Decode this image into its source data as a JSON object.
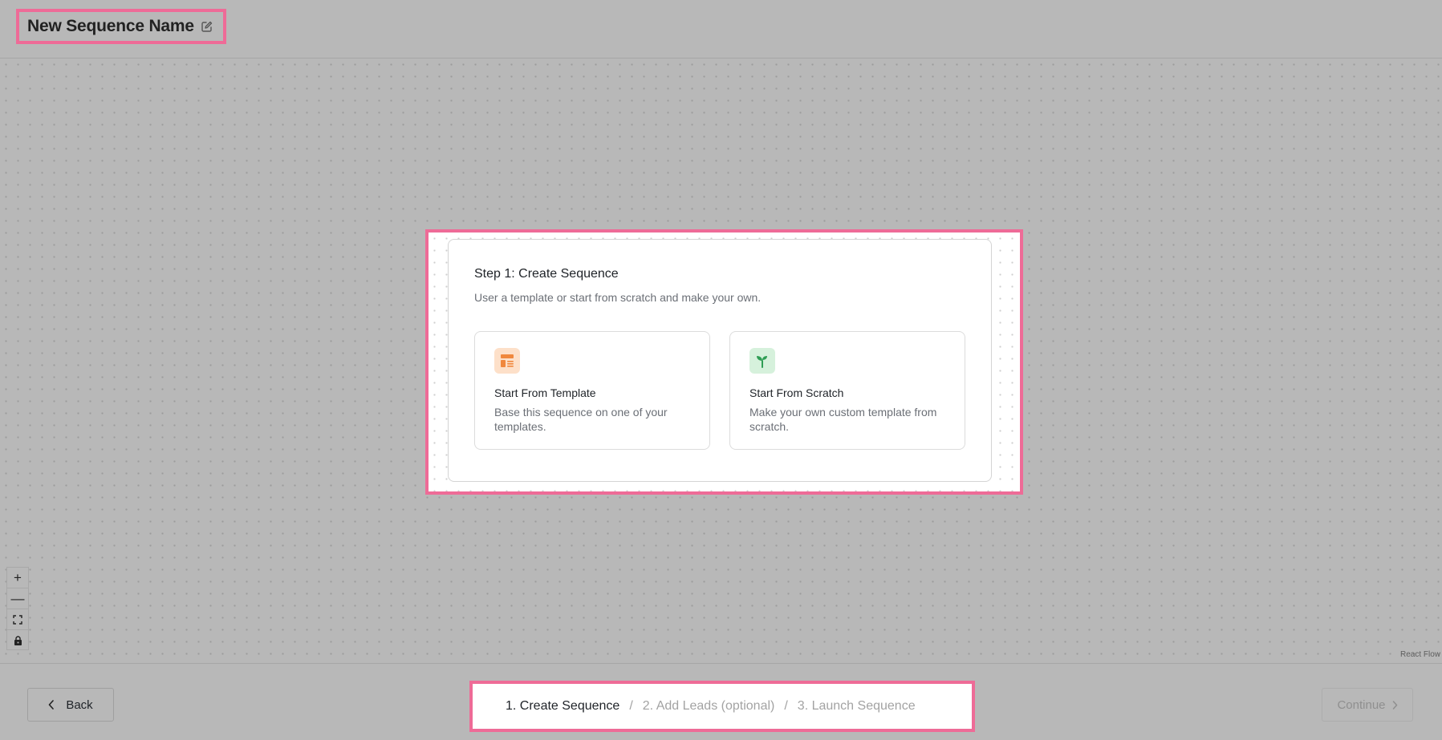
{
  "header": {
    "title": "New Sequence Name",
    "edit_icon": "pencil-square-icon"
  },
  "card": {
    "title": "Step 1: Create Sequence",
    "subtitle": "User a template or start from scratch and make your own.",
    "options": [
      {
        "title": "Start From Template",
        "description": "Base this sequence on one of your templates.",
        "icon": "template-layout-icon",
        "icon_color": "#f0883e",
        "icon_bg": "#fde0c9"
      },
      {
        "title": "Start From Scratch",
        "description": "Make your own custom template from scratch.",
        "icon": "sprout-icon",
        "icon_color": "#2f9e55",
        "icon_bg": "#d6f1dc"
      }
    ]
  },
  "zoom_controls": {
    "zoom_in": "+",
    "zoom_out": "—",
    "fit_view": "fit-view-icon",
    "lock": "lock-icon"
  },
  "attribution": "React Flow",
  "footer": {
    "back_label": "Back",
    "steps": [
      {
        "label": "1. Create Sequence",
        "active": true
      },
      {
        "label": "2. Add Leads (optional)",
        "active": false
      },
      {
        "label": "3. Launch Sequence",
        "active": false
      }
    ],
    "separator": "/",
    "continue_label": "Continue"
  },
  "colors": {
    "highlight": "#ee6b97",
    "canvas_bg": "#b8b8b8"
  }
}
